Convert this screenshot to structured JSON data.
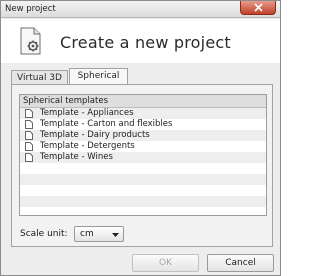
{
  "window": {
    "title": "New project"
  },
  "header": {
    "heading": "Create a new project"
  },
  "tabs": [
    {
      "label": "Virtual 3D",
      "active": false
    },
    {
      "label": "Spherical",
      "active": true
    }
  ],
  "templates": {
    "header": "Spherical templates",
    "items": [
      "Template - Appliances",
      "Template - Carton and flexibles",
      "Template - Dairy products",
      "Template - Detergents",
      "Template - Wines"
    ]
  },
  "scale": {
    "label": "Scale unit:",
    "value": "cm"
  },
  "buttons": {
    "ok": "OK",
    "cancel": "Cancel"
  },
  "colors": {
    "close_button": "#c0412b",
    "disabled_text": "#a8a8a8"
  }
}
